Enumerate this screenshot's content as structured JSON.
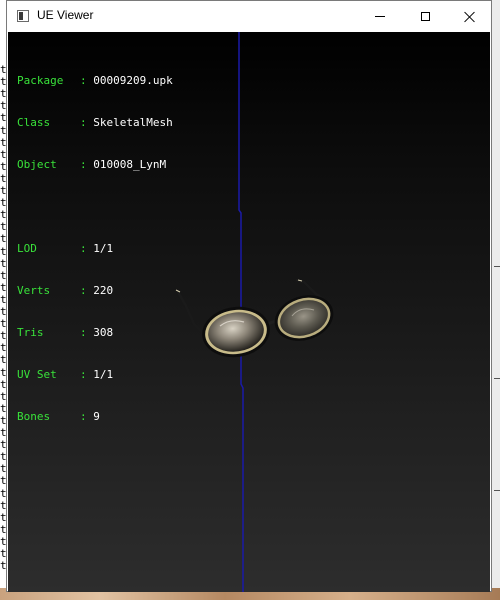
{
  "window": {
    "title": "UE Viewer"
  },
  "info": {
    "package": {
      "label": "Package",
      "value": "00009209.upk"
    },
    "class": {
      "label": "Class",
      "value": "SkeletalMesh"
    },
    "object": {
      "label": "Object",
      "value": "010008_LynM"
    },
    "lod": {
      "label": "LOD",
      "value": "1/1"
    },
    "verts": {
      "label": "Verts",
      "value": "220"
    },
    "tris": {
      "label": "Tris",
      "value": "308"
    },
    "uvset": {
      "label": "UV Set",
      "value": "1/1"
    },
    "bones": {
      "label": "Bones",
      "value": "9"
    }
  },
  "background_console": {
    "char": "t"
  },
  "colors": {
    "label_green": "#39e23a",
    "value_white": "#ffffff",
    "axis_blue": "#1a1aa8"
  }
}
